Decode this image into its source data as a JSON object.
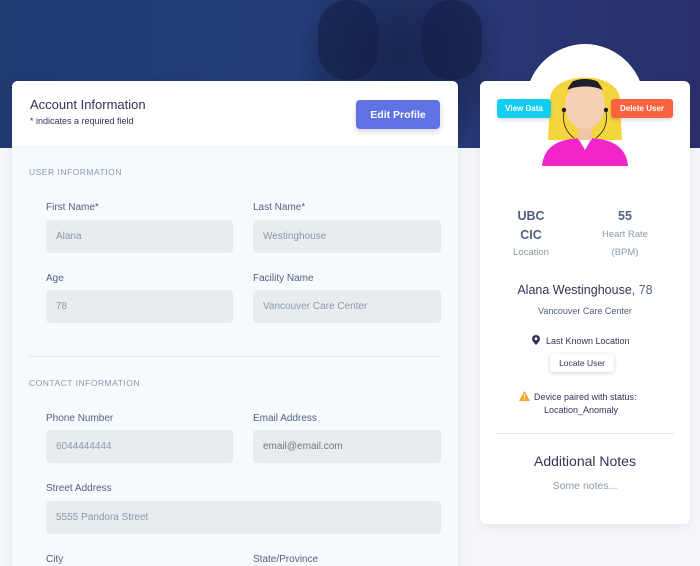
{
  "account": {
    "title": "Account Information",
    "subtitle": "* indicates a required field",
    "edit_label": "Edit Profile"
  },
  "user_info": {
    "section_title": "USER INFORMATION",
    "first_name_label": "First Name*",
    "first_name_value": "Alana",
    "last_name_label": "Last Name*",
    "last_name_value": "Westinghouse",
    "age_label": "Age",
    "age_value": "78",
    "facility_label": "Facility Name",
    "facility_value": "Vancouver Care Center"
  },
  "contact_info": {
    "section_title": "CONTACT INFORMATION",
    "phone_label": "Phone Number",
    "phone_value": "6044444444",
    "email_label": "Email Address",
    "email_placeholder": "email@email.com",
    "street_label": "Street Address",
    "street_value": "5555 Pandora Street",
    "city_label": "City",
    "state_label": "State/Province"
  },
  "profile": {
    "view_data_label": "View Data",
    "delete_user_label": "Delete User",
    "location_value_line1": "UBC",
    "location_value_line2": "CIC",
    "location_label": "Location",
    "heart_rate_value": "55",
    "heart_rate_label_line1": "Heart Rate",
    "heart_rate_label_line2": "(BPM)",
    "name": "Alana Westinghouse",
    "age_suffix": ", 78",
    "facility": "Vancouver Care Center",
    "last_known_location_label": "Last Known Location",
    "locate_user_label": "Locate User",
    "device_status_line1": "Device paired with status:",
    "device_status_line2": "Location_Anomaly",
    "notes_title": "Additional Notes",
    "notes_text": "Some notes..."
  },
  "colors": {
    "primary": "#5e72e4",
    "info": "#11cdef",
    "danger": "#fb6340",
    "warning": "#f5a623",
    "hero": "#233a74"
  },
  "icons": {
    "location": "map-pin-icon",
    "warning": "warning-icon",
    "avatar": "avatar-icon"
  }
}
